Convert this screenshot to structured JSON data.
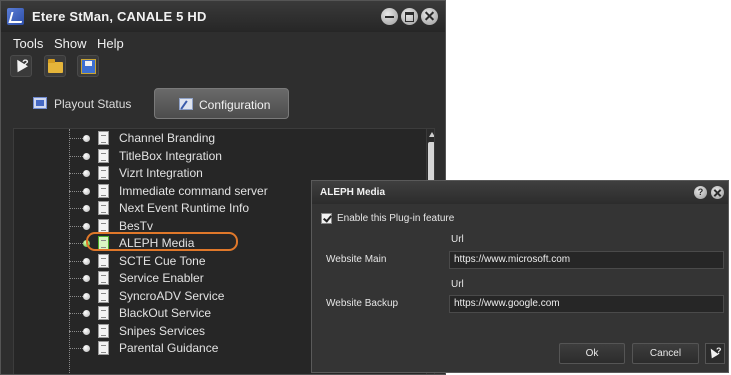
{
  "window": {
    "title": "Etere StMan, CANALE 5 HD"
  },
  "menu": {
    "items": [
      "Tools",
      "Show",
      "Help"
    ]
  },
  "tabs": {
    "playout": "Playout Status",
    "configuration": "Configuration"
  },
  "tree": {
    "items": [
      "Channel Branding",
      "TitleBox Integration",
      "Vizrt Integration",
      "Immediate command server",
      "Next Event Runtime Info",
      "BesTv",
      "ALEPH Media",
      "SCTE Cue Tone",
      "Service Enabler",
      "SyncroADV Service",
      "BlackOut Service",
      "Snipes Services",
      "Parental Guidance"
    ],
    "selected": "ALEPH Media"
  },
  "dialog": {
    "title": "ALEPH Media",
    "enable_label": "Enable this Plug-in feature",
    "enable_checked": true,
    "url_label": "Url",
    "website_main_label": "Website Main",
    "website_main_value": "https://www.microsoft.com",
    "website_backup_label": "Website Backup",
    "website_backup_value": "https://www.google.com",
    "ok": "Ok",
    "cancel": "Cancel"
  },
  "colors": {
    "highlight": "#e0782a",
    "active_bullet": "#4fb82a"
  },
  "icons": [
    "app-icon",
    "minimize-icon",
    "maximize-icon",
    "close-icon",
    "help-cursor-icon",
    "folder-icon",
    "save-icon",
    "monitor-icon",
    "config-icon",
    "document-icon"
  ]
}
